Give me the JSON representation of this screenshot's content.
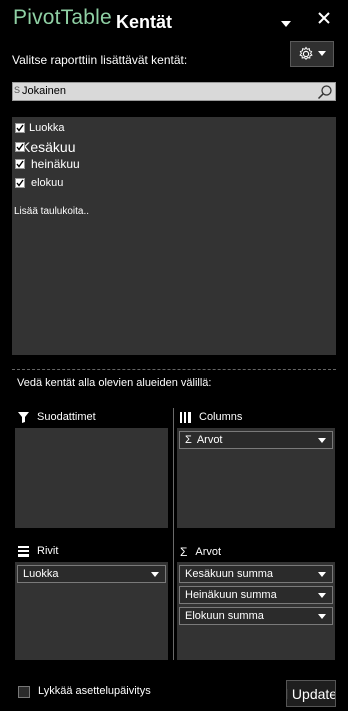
{
  "header": {
    "title_prefix": "PivotTable",
    "title": "Kentät",
    "menu_icon": "dropdown-triangle-icon",
    "close_icon": "close-icon"
  },
  "instruction": "Valitse raporttiin lisättävät kentät:",
  "settings": {
    "icon": "gear-icon"
  },
  "search": {
    "placeholder": "S",
    "value": "Jokainen"
  },
  "fields": [
    {
      "label": "Luokka",
      "checked": true
    },
    {
      "label": "Kesäkuu",
      "checked": true
    },
    {
      "label": "heinäkuu",
      "checked": true
    },
    {
      "label": "elokuu",
      "checked": true
    }
  ],
  "add_tables": "Lisää taulukoita..",
  "drag_hint": "Vedä kentät alla olevien alueiden välillä:",
  "areas": {
    "filters": {
      "title": "Suodattimet",
      "icon": "filter-icon",
      "items": []
    },
    "columns": {
      "title": "Columns",
      "icon": "columns-icon",
      "items": [
        "Arvot"
      ]
    },
    "rows": {
      "title": "Rivit",
      "icon": "rows-icon",
      "items": [
        "Luokka"
      ]
    },
    "values": {
      "title": "Arvot",
      "icon": "sigma-icon",
      "items": [
        "Kesäkuun summa",
        "Heinäkuun summa",
        "Elokuun summa"
      ]
    }
  },
  "footer": {
    "defer_label": "Lykkää asettelupäivitys",
    "update_label": "l Update"
  }
}
